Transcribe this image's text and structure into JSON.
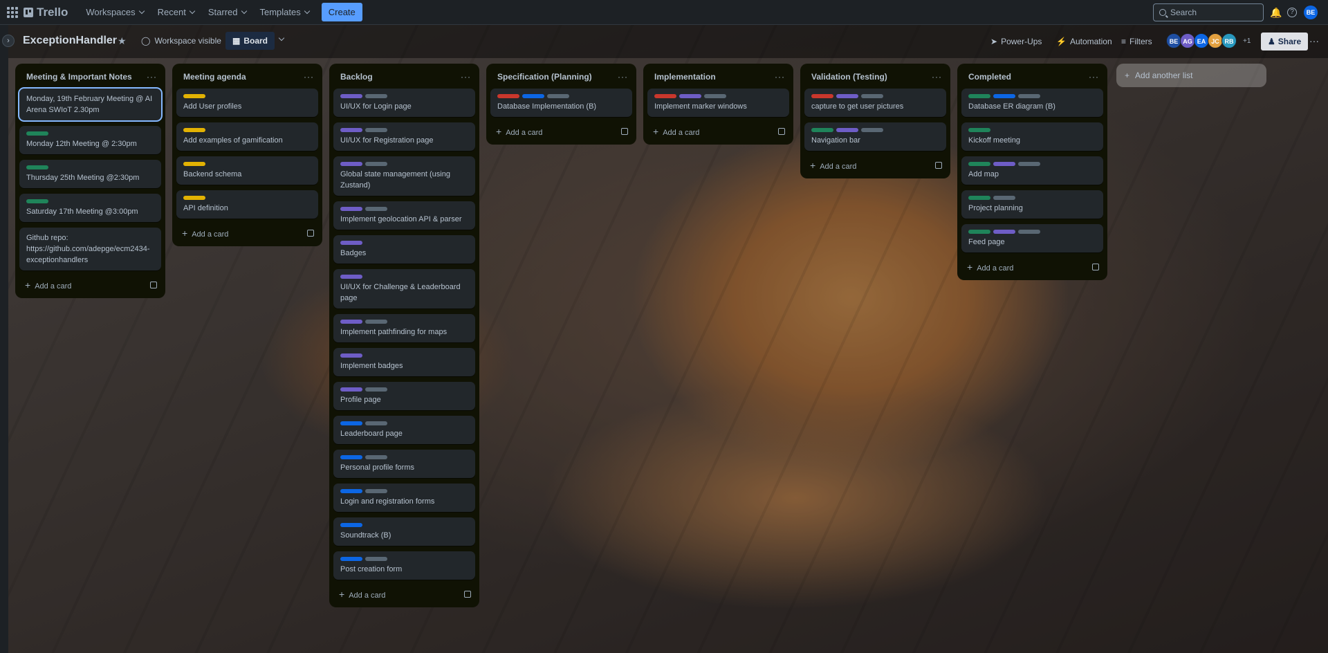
{
  "topnav": {
    "logo": "Trello",
    "menus": [
      "Workspaces",
      "Recent",
      "Starred",
      "Templates"
    ],
    "create_label": "Create",
    "search_placeholder": "Search",
    "avatar": "BE"
  },
  "board": {
    "title": "ExceptionHandler",
    "visibility": "Workspace visible",
    "view_label": "Board",
    "powerups_label": "Power-Ups",
    "automation_label": "Automation",
    "filters_label": "Filters",
    "members": [
      {
        "initials": "BE",
        "color": "#1f4fa3"
      },
      {
        "initials": "AG",
        "color": "#6e5dc6"
      },
      {
        "initials": "EA",
        "color": "#0c66e4"
      },
      {
        "initials": "JC",
        "color": "#e2a03f"
      },
      {
        "initials": "RB",
        "color": "#2898bd"
      }
    ],
    "members_more": "+1",
    "share_label": "Share",
    "add_list_label": "Add another list"
  },
  "colors": {
    "green": "#1f845a",
    "yellow": "#e2b203",
    "purple": "#6e5dc6",
    "blue": "#0c66e4",
    "red": "#c9372c",
    "gray": "#596773"
  },
  "add_card_label": "Add a card",
  "lists": [
    {
      "title": "Meeting & Important Notes",
      "cards": [
        {
          "labels": [],
          "text": "Monday, 19th February Meeting @ AI Arena SWIoT 2.30pm",
          "focused": true
        },
        {
          "labels": [
            "green"
          ],
          "text": "Monday 12th Meeting @ 2:30pm"
        },
        {
          "labels": [
            "green"
          ],
          "text": "Thursday 25th Meeting @2:30pm"
        },
        {
          "labels": [
            "green"
          ],
          "text": "Saturday 17th Meeting @3:00pm"
        },
        {
          "labels": [],
          "text": "Github repo: https://github.com/adepge/ecm2434-exceptionhandlers"
        }
      ]
    },
    {
      "title": "Meeting agenda",
      "cards": [
        {
          "labels": [
            "yellow"
          ],
          "text": "Add User profiles"
        },
        {
          "labels": [
            "yellow"
          ],
          "text": "Add examples of gamification"
        },
        {
          "labels": [
            "yellow"
          ],
          "text": "Backend schema"
        },
        {
          "labels": [
            "yellow"
          ],
          "text": "API definition"
        }
      ]
    },
    {
      "title": "Backlog",
      "cards": [
        {
          "labels": [
            "purple",
            "gray"
          ],
          "text": "UI/UX for Login page"
        },
        {
          "labels": [
            "purple",
            "gray"
          ],
          "text": "UI/UX for Registration page"
        },
        {
          "labels": [
            "purple",
            "gray"
          ],
          "text": "Global state management (using Zustand)"
        },
        {
          "labels": [
            "purple",
            "gray"
          ],
          "text": "Implement geolocation API & parser"
        },
        {
          "labels": [
            "purple"
          ],
          "text": "Badges"
        },
        {
          "labels": [
            "purple"
          ],
          "text": "UI/UX for Challenge & Leaderboard page"
        },
        {
          "labels": [
            "purple",
            "gray"
          ],
          "text": "Implement pathfinding for maps"
        },
        {
          "labels": [
            "purple"
          ],
          "text": "Implement badges"
        },
        {
          "labels": [
            "purple",
            "gray"
          ],
          "text": "Profile page"
        },
        {
          "labels": [
            "blue",
            "gray"
          ],
          "text": "Leaderboard page"
        },
        {
          "labels": [
            "blue",
            "gray"
          ],
          "text": "Personal profile forms"
        },
        {
          "labels": [
            "blue",
            "gray"
          ],
          "text": "Login and registration forms"
        },
        {
          "labels": [
            "blue"
          ],
          "text": "Soundtrack (B)"
        },
        {
          "labels": [
            "blue",
            "gray"
          ],
          "text": "Post creation form"
        }
      ]
    },
    {
      "title": "Specification (Planning)",
      "cards": [
        {
          "labels": [
            "red",
            "blue",
            "gray"
          ],
          "text": "Database Implementation (B)"
        }
      ]
    },
    {
      "title": "Implementation",
      "cards": [
        {
          "labels": [
            "red",
            "purple",
            "gray"
          ],
          "text": "Implement marker windows"
        }
      ]
    },
    {
      "title": "Validation (Testing)",
      "cards": [
        {
          "labels": [
            "red",
            "purple",
            "gray"
          ],
          "text": "capture to get user pictures"
        },
        {
          "labels": [
            "green",
            "purple",
            "gray"
          ],
          "text": "Navigation bar"
        }
      ]
    },
    {
      "title": "Completed",
      "cards": [
        {
          "labels": [
            "green",
            "blue",
            "gray"
          ],
          "text": "Database ER diagram (B)"
        },
        {
          "labels": [
            "green"
          ],
          "text": "Kickoff meeting"
        },
        {
          "labels": [
            "green",
            "purple",
            "gray"
          ],
          "text": "Add map"
        },
        {
          "labels": [
            "green",
            "gray"
          ],
          "text": "Project planning"
        },
        {
          "labels": [
            "green",
            "purple",
            "gray"
          ],
          "text": "Feed page"
        }
      ]
    }
  ]
}
